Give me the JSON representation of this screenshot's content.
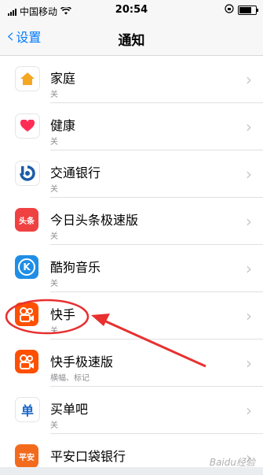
{
  "status_bar": {
    "carrier": "中国移动",
    "time": "20:54"
  },
  "nav": {
    "back_label": "设置",
    "title": "通知"
  },
  "apps": [
    {
      "name": "家庭",
      "subtitle": "关",
      "icon": "home-icon"
    },
    {
      "name": "健康",
      "subtitle": "关",
      "icon": "health-heart-icon"
    },
    {
      "name": "交通银行",
      "subtitle": "关",
      "icon": "bank-of-communications-icon"
    },
    {
      "name": "今日头条极速版",
      "subtitle": "关",
      "icon": "toutiao-icon",
      "icon_text": "头条"
    },
    {
      "name": "酷狗音乐",
      "subtitle": "关",
      "icon": "kugou-k-icon",
      "icon_text": "K"
    },
    {
      "name": "快手",
      "subtitle": "关",
      "icon": "kuaishou-icon"
    },
    {
      "name": "快手极速版",
      "subtitle": "横幅、标记",
      "icon": "kuaishou-express-icon"
    },
    {
      "name": "买单吧",
      "subtitle": "关",
      "icon": "maidanba-icon",
      "icon_text": "单"
    },
    {
      "name": "平安口袋银行",
      "subtitle": "",
      "icon": "pingan-bank-icon",
      "icon_text": "平安"
    }
  ],
  "watermark": "Baidu经验",
  "colors": {
    "accent": "#007aff",
    "annotation": "#e8302f"
  }
}
